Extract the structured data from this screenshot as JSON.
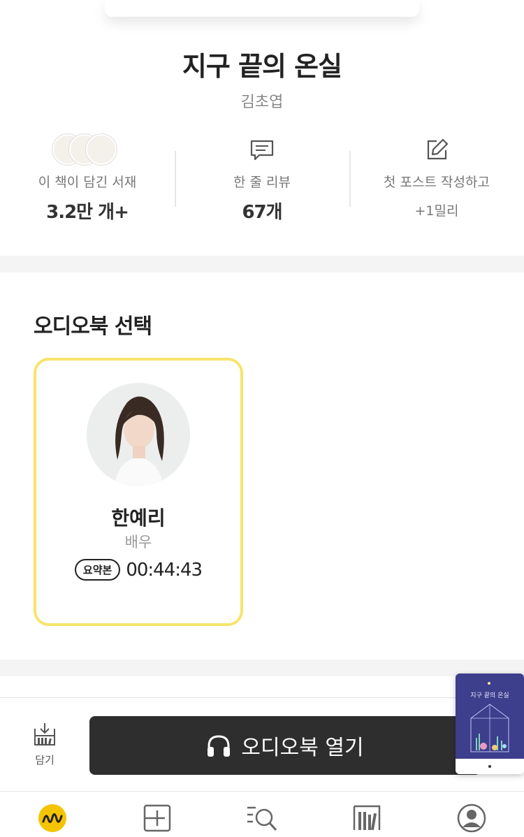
{
  "book": {
    "title": "지구 끝의 온실",
    "author": "김초엽"
  },
  "stats": {
    "shelves": {
      "label": "이 책이 담긴 서재",
      "value": "3.2만 개+"
    },
    "reviews": {
      "label": "한 줄 리뷰",
      "value": "67개"
    },
    "post": {
      "label": "첫 포스트 작성하고",
      "sub": "+1밀리"
    }
  },
  "audiobook": {
    "section_title": "오디오북 선택",
    "narrator": {
      "name": "한예리",
      "role": "배우",
      "tag": "요약본",
      "duration": "00:44:43"
    }
  },
  "actions": {
    "save_label": "담기",
    "open_label": "오디오북 열기"
  },
  "mini_cover": {
    "title": "지구 끝의 온실"
  },
  "tabs": [
    "today-icon",
    "add-icon",
    "search-icon",
    "library-icon",
    "profile-icon"
  ],
  "colors": {
    "accent_yellow": "#f7e46b",
    "brand_yellow": "#f5c400",
    "button_dark": "#2e2e2e"
  }
}
